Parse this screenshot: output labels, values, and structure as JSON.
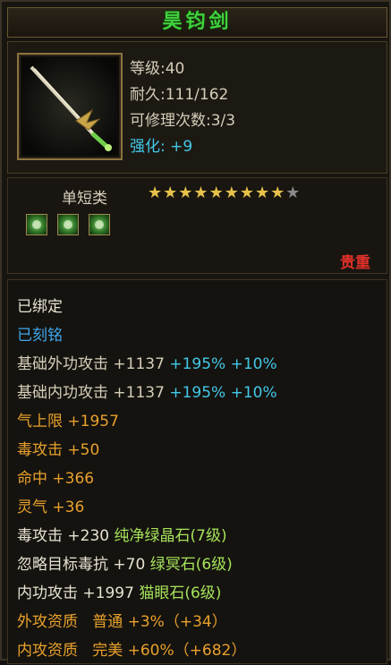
{
  "item": {
    "name": "昊钧剑",
    "stats": {
      "level": "等级:40",
      "durability": "耐久:111/162",
      "repairs": "可修理次数:3/3",
      "enhance_label": "强化:",
      "enhance_value": "+9"
    },
    "type": "单短类",
    "stars": {
      "filled": 9,
      "total": 10
    },
    "quality": "贵重",
    "gem_icons": [
      "green-gem-icon",
      "green-gem-icon",
      "green-gem-icon"
    ],
    "bind_status": "已绑定",
    "engrave_status": "已刻铭",
    "attributes": [
      {
        "label": "基础外功攻击",
        "value": "+1137",
        "bonus1": "+195%",
        "bonus2": "+10%"
      },
      {
        "label": "基础内功攻击",
        "value": "+1137",
        "bonus1": "+195%",
        "bonus2": "+10%"
      }
    ],
    "extras": [
      {
        "label": "气上限",
        "value": "+1957"
      },
      {
        "label": "毒攻击",
        "value": "+50"
      },
      {
        "label": "命中",
        "value": "+366"
      },
      {
        "label": "灵气",
        "value": "+36"
      }
    ],
    "gem_stats": [
      {
        "label": "毒攻击",
        "value": "+230",
        "gem": "纯净绿晶石(7级)"
      },
      {
        "label": "忽略目标毒抗",
        "value": "+70",
        "gem": "绿冥石(6级)"
      },
      {
        "label": "内功攻击",
        "value": "+1997",
        "gem": "猫眼石(6级)"
      }
    ],
    "aptitudes": [
      {
        "label": "外攻资质",
        "grade": "普通",
        "value": "+3%（+34）"
      },
      {
        "label": "内攻资质",
        "grade": "完美",
        "value": "+60%（+682）"
      }
    ]
  }
}
